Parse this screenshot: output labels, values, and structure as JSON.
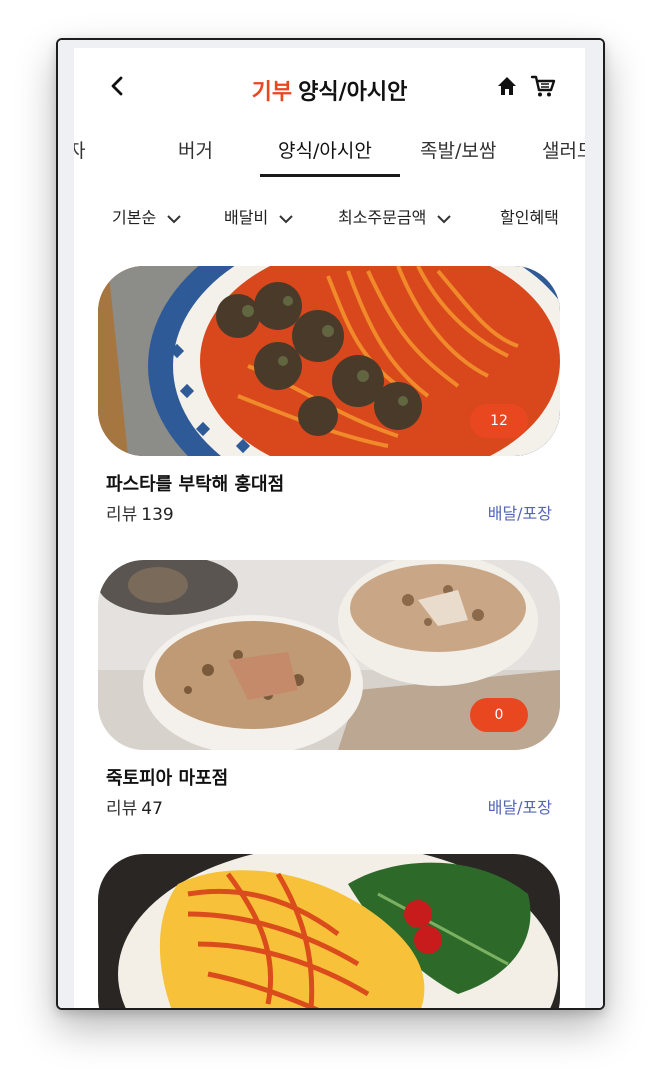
{
  "header": {
    "brand": "기부",
    "category": "양식/아시안"
  },
  "tabs": [
    {
      "label": "자"
    },
    {
      "label": "버거"
    },
    {
      "label": "양식/아시안"
    },
    {
      "label": "족발/보쌈"
    },
    {
      "label": "샐러드"
    }
  ],
  "filters": [
    {
      "label": "기본순"
    },
    {
      "label": "배달비"
    },
    {
      "label": "최소주문금액"
    },
    {
      "label": "할인혜택"
    }
  ],
  "stores": [
    {
      "name": "파스타를 부탁해 홍대점",
      "review_label": "리뷰",
      "review_count": "139",
      "badge": "12",
      "delivery": "배달/포장"
    },
    {
      "name": "죽토피아 마포점",
      "review_label": "리뷰",
      "review_count": "47",
      "badge": "0",
      "delivery": "배달/포장"
    },
    {
      "name": "",
      "review_label": "",
      "review_count": "",
      "badge": "",
      "delivery": ""
    }
  ],
  "colors": {
    "accent": "#e8471f",
    "link": "#5565b8"
  }
}
